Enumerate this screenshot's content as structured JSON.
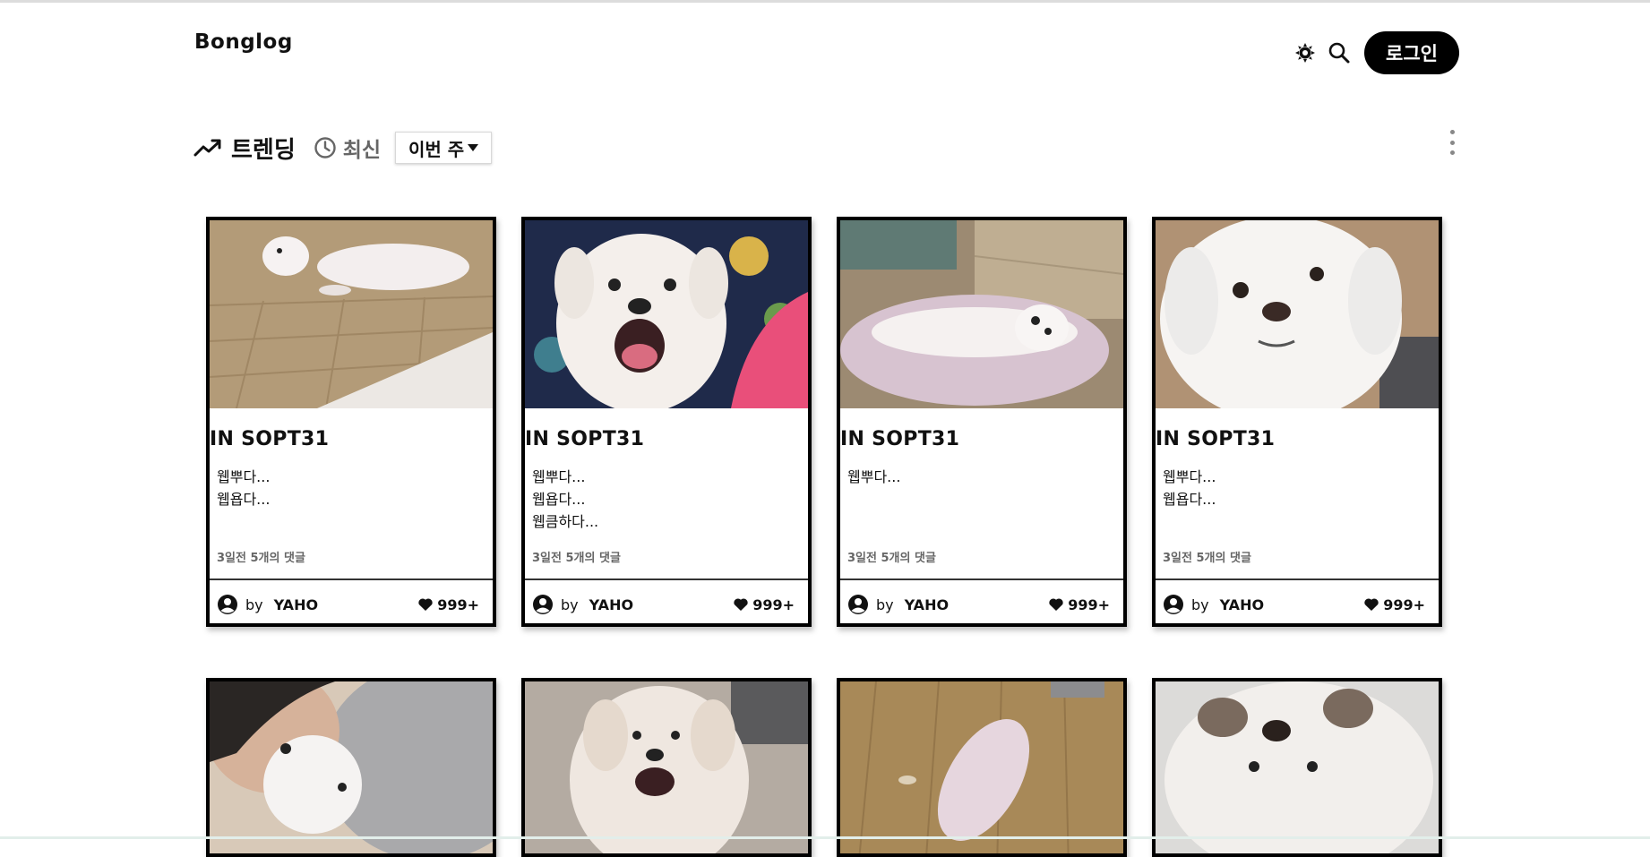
{
  "header": {
    "logo": "Bonglog",
    "login_label": "로그인"
  },
  "tabs": {
    "trending_label": "트렌딩",
    "recent_label": "최신",
    "period_value": "이번 주"
  },
  "colors": {
    "accent": "#000000",
    "background": "#ffffff",
    "muted_text": "#666666"
  },
  "icons": {
    "theme": "sun-icon",
    "search": "search-icon",
    "trending": "trending-up-icon",
    "recent": "clock-icon",
    "more": "more-vertical-icon",
    "avatar": "user-circle-icon",
    "likes": "heart-icon"
  },
  "cards": [
    {
      "title": "IN SOPT31",
      "lines": [
        "웹뿌다...",
        "웹욥다..."
      ],
      "meta": "3일전 5개의 댓글",
      "author_prefix": "by",
      "author": "YAHO",
      "likes": "999+"
    },
    {
      "title": "IN SOPT31",
      "lines": [
        "웹뿌다...",
        "웹욥다...",
        "웹큼하다..."
      ],
      "meta": "3일전 5개의 댓글",
      "author_prefix": "by",
      "author": "YAHO",
      "likes": "999+"
    },
    {
      "title": "IN SOPT31",
      "lines": [
        "웹뿌다..."
      ],
      "meta": "3일전 5개의 댓글",
      "author_prefix": "by",
      "author": "YAHO",
      "likes": "999+"
    },
    {
      "title": "IN SOPT31",
      "lines": [
        "웹뿌다...",
        "웹욥다..."
      ],
      "meta": "3일전 5개의 댓글",
      "author_prefix": "by",
      "author": "YAHO",
      "likes": "999+"
    }
  ]
}
